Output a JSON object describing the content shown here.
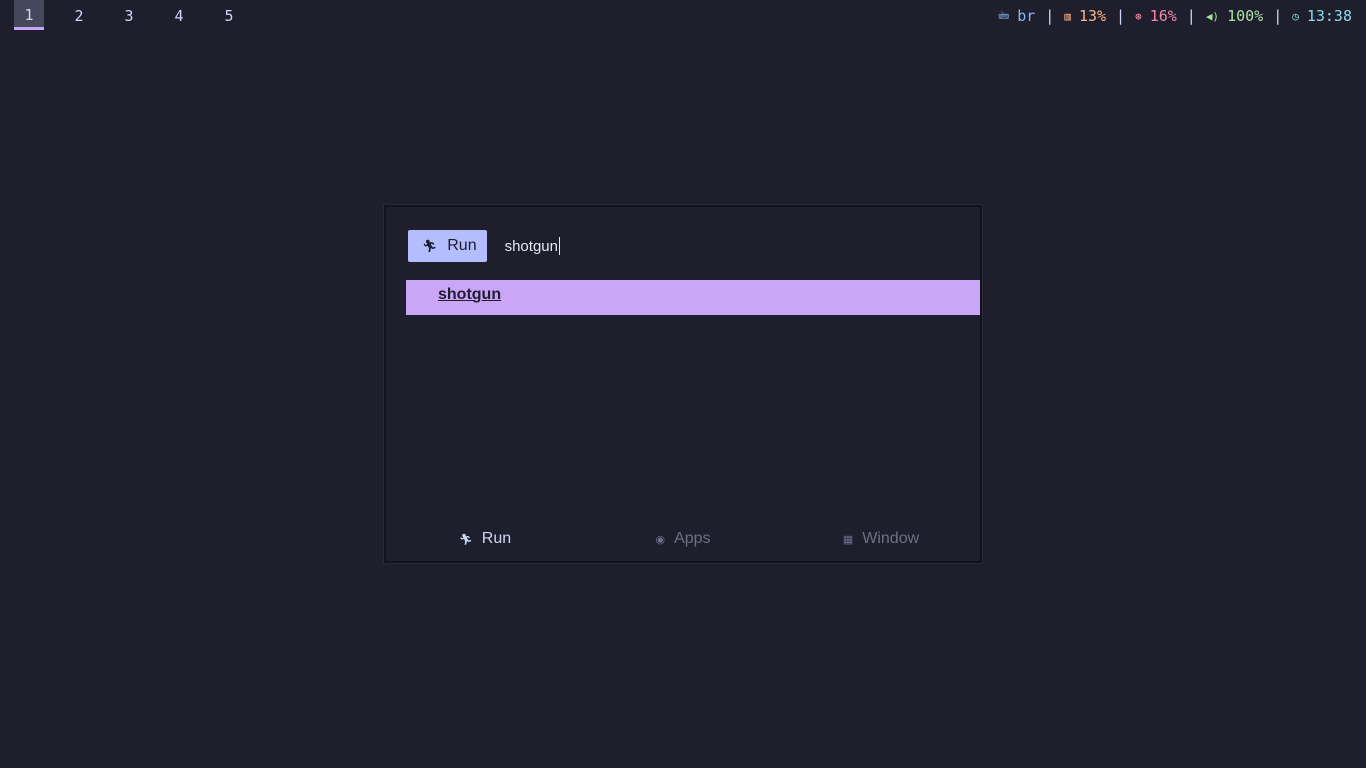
{
  "topbar": {
    "workspaces": [
      {
        "label": "1",
        "active": true
      },
      {
        "label": "2",
        "active": false
      },
      {
        "label": "3",
        "active": false
      },
      {
        "label": "4",
        "active": false
      },
      {
        "label": "5",
        "active": false
      }
    ],
    "keyboard_layout": {
      "icon": "keyboard-icon",
      "value": "br"
    },
    "cpu": {
      "icon": "cpu-icon",
      "value": "13%"
    },
    "memory": {
      "icon": "memory-icon",
      "value": "16%"
    },
    "volume": {
      "icon": "speaker-icon",
      "value": "100%"
    },
    "clock": {
      "icon": "clock-icon",
      "value": "13:38"
    },
    "separator": "|"
  },
  "launcher": {
    "prompt_label": "Run",
    "prompt_icon": "run-icon",
    "query": "shotgun",
    "results": [
      {
        "label": "shotgun",
        "selected": true
      }
    ],
    "modes": [
      {
        "label": "Run",
        "icon": "run-icon",
        "active": true
      },
      {
        "label": "Apps",
        "icon": "apps-icon",
        "active": false
      },
      {
        "label": "Window",
        "icon": "window-icon",
        "active": false
      }
    ]
  },
  "colors": {
    "background": "#1f1e2c",
    "accent": "#cba6f7",
    "prompt_badge": "#b4befe"
  }
}
